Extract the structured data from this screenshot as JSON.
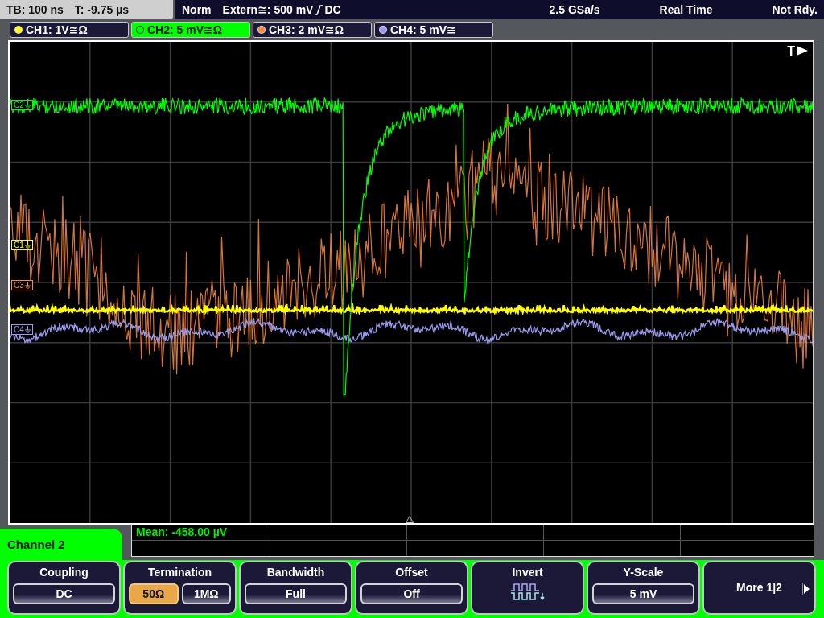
{
  "status_bar": {
    "timebase": "TB: 100 ns",
    "trigger_time": "T: -9.75 µs",
    "mode": "Norm",
    "trigger_source": "Extern≅: 500 mV",
    "trigger_coupling": "DC",
    "sample_rate": "2.5 GSa/s",
    "acquisition": "Real Time",
    "state": "Not Rdy."
  },
  "channels": [
    {
      "label": "CH1: 1V≅Ω",
      "color": "#ffff00",
      "selected": false
    },
    {
      "label": "CH2: 5 mV≅Ω",
      "color": "#00ff00",
      "selected": true
    },
    {
      "label": "CH3: 2 mV≅Ω",
      "color": "#ff8a3c",
      "selected": false
    },
    {
      "label": "CH4: 5 mV≅",
      "color": "#9a9af0",
      "selected": false
    }
  ],
  "markers": [
    {
      "label": "C2",
      "color": "#00ff00"
    },
    {
      "label": "C1",
      "color": "#ffff00"
    },
    {
      "label": "C3",
      "color": "#ff8a3c"
    },
    {
      "label": "C4",
      "color": "#9a9af0"
    }
  ],
  "trigger_label": "T",
  "measurement": "Mean: -458.00 µV",
  "menu": {
    "title": "Channel 2",
    "softkeys": [
      {
        "kind": "value",
        "label": "Coupling",
        "value": "DC"
      },
      {
        "kind": "options",
        "label": "Termination",
        "options": [
          {
            "text": "50Ω",
            "selected": true
          },
          {
            "text": "1MΩ",
            "selected": false
          }
        ]
      },
      {
        "kind": "value",
        "label": "Bandwidth",
        "value": "Full"
      },
      {
        "kind": "value",
        "label": "Offset",
        "value": "Off"
      },
      {
        "kind": "icon",
        "label": "Invert"
      },
      {
        "kind": "value",
        "label": "Y-Scale",
        "value": "5 mV"
      },
      {
        "kind": "more",
        "label": "More 1|2"
      }
    ]
  }
}
